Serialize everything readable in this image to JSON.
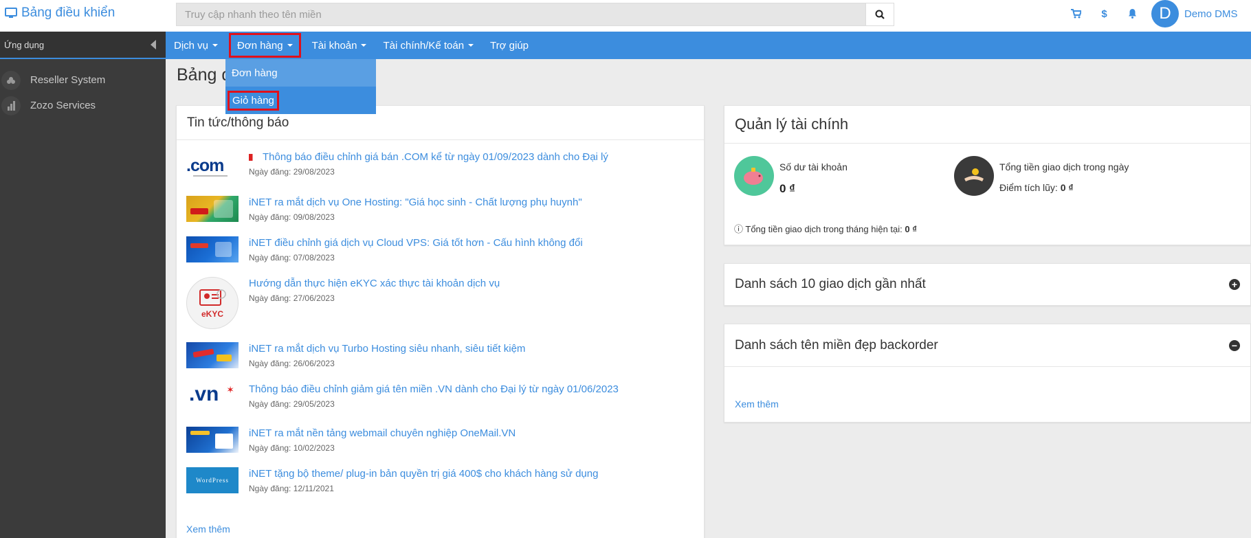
{
  "brand": {
    "title": "Bảng điều khiển",
    "icon": "monitor-icon"
  },
  "search": {
    "placeholder": "Truy cập nhanh theo tên miền"
  },
  "top_icons": [
    "cart-icon",
    "dollar-icon",
    "bell-icon"
  ],
  "user": {
    "initial": "D",
    "name": "Demo DMS"
  },
  "sidebar": {
    "header": "Ứng dụng",
    "items": [
      {
        "label": "Reseller System",
        "icon": "cloud-icon"
      },
      {
        "label": "Zozo Services",
        "icon": "chart-icon"
      }
    ]
  },
  "nav": {
    "items": [
      {
        "label": "Dịch vụ"
      },
      {
        "label": "Đơn hàng"
      },
      {
        "label": "Tài khoản"
      },
      {
        "label": "Tài chính/Kế toán"
      },
      {
        "label": "Trợ giúp"
      }
    ],
    "dropdown": [
      {
        "label": "Đơn hàng"
      },
      {
        "label": "Giỏ hàng"
      }
    ]
  },
  "page_title": "Bảng đ",
  "news": {
    "title": "Tin tức/thông báo",
    "items": [
      {
        "title": "Thông báo điều chỉnh giá bán .COM kể từ ngày 01/09/2023 dành cho Đại lý",
        "date": "Ngày đăng: 29/08/2023",
        "thumb": "com"
      },
      {
        "title": "iNET ra mắt dịch vụ One Hosting: \"Giá học sinh - Chất lượng phụ huynh\"",
        "date": "Ngày đăng: 09/08/2023",
        "thumb": "hosting"
      },
      {
        "title": "iNET điều chỉnh giá dịch vụ Cloud VPS: Giá tốt hơn - Cấu hình không đổi",
        "date": "Ngày đăng: 07/08/2023",
        "thumb": "vps"
      },
      {
        "title": "Hướng dẫn thực hiện eKYC xác thực tài khoản dịch vụ",
        "date": "Ngày đăng: 27/06/2023",
        "thumb": "ekyc",
        "thumb_text": "eKYC"
      },
      {
        "title": "iNET ra mắt dịch vụ Turbo Hosting siêu nhanh, siêu tiết kiệm",
        "date": "Ngày đăng: 26/06/2023",
        "thumb": "turbo"
      },
      {
        "title": "Thông báo điều chỉnh giảm giá tên miền .VN dành cho Đại lý từ ngày 01/06/2023",
        "date": "Ngày đăng: 29/05/2023",
        "thumb": "vn"
      },
      {
        "title": "iNET ra mắt nền tảng webmail chuyên nghiệp OneMail.VN",
        "date": "Ngày đăng: 10/02/2023",
        "thumb": "onemail"
      },
      {
        "title": "iNET tặng bộ theme/ plug-in bản quyền trị giá 400$ cho khách hàng sử dụng",
        "date": "Ngày đăng: 12/11/2021",
        "thumb": "wordpress",
        "thumb_text": "WordPress"
      }
    ],
    "more": "Xem thêm",
    "com_logo": ".com",
    "vn_logo": ".vn"
  },
  "finance": {
    "title": "Quản lý tài chính",
    "balance_label": "Số dư tài khoản",
    "balance_value": "0 ₫",
    "daily_label": "Tổng tiền giao dịch trong ngày",
    "points_label": "Điểm tích lũy:",
    "points_value": "0 ₫",
    "month_label": "ⓘ Tổng tiền giao dịch trong tháng hiện tại:",
    "month_value": "0 ₫"
  },
  "recent": {
    "title": "Danh sách 10 giao dịch gần nhất",
    "toggle": "+"
  },
  "backorder": {
    "title": "Danh sách tên miền đẹp backorder",
    "toggle": "−",
    "more": "Xem thêm"
  },
  "colors": {
    "primary": "#3c8dde",
    "highlight": "#e0101b",
    "sidebar": "#3b3b3b"
  }
}
